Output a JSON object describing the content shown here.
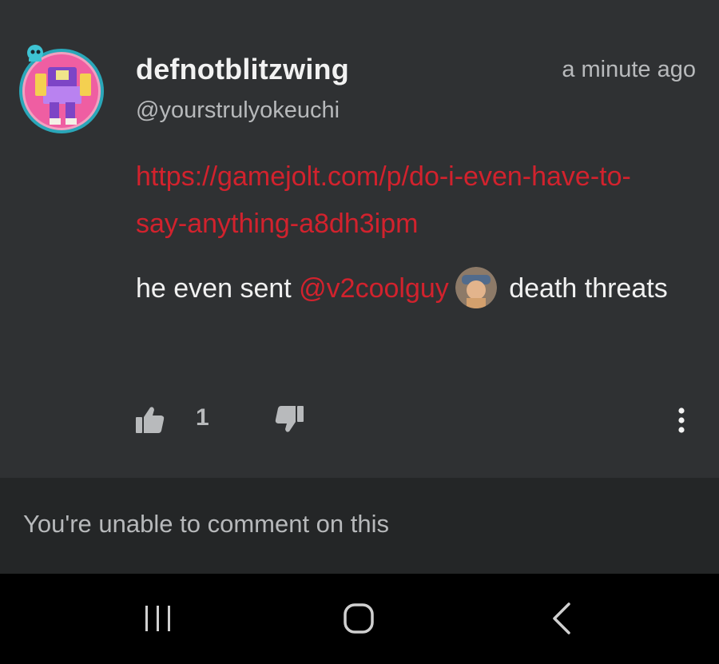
{
  "post": {
    "author": "defnotblitzwing",
    "handle": "@yourstrulyokeuchi",
    "timestamp": "a minute ago",
    "link": "https://gamejolt.com/p/do-i-even-have-to-say-anything-a8dh3ipm",
    "message_before": "he even sent ",
    "mention": "@v2coolguy",
    "message_after": " death threats",
    "likes": "1"
  },
  "comment_notice": "You're unable to comment on this",
  "icons": {
    "avatar": "robot-avatar-icon",
    "mention_avatar": "user-avatar-icon",
    "like": "thumbs-up-icon",
    "dislike": "thumbs-down-icon",
    "more": "more-vertical-icon",
    "nav_recent": "recent-apps-icon",
    "nav_home": "home-icon",
    "nav_back": "back-icon"
  },
  "colors": {
    "background": "#2f3133",
    "accent_red": "#d2222d",
    "comment_bar": "#242627",
    "navbar": "#000000"
  }
}
